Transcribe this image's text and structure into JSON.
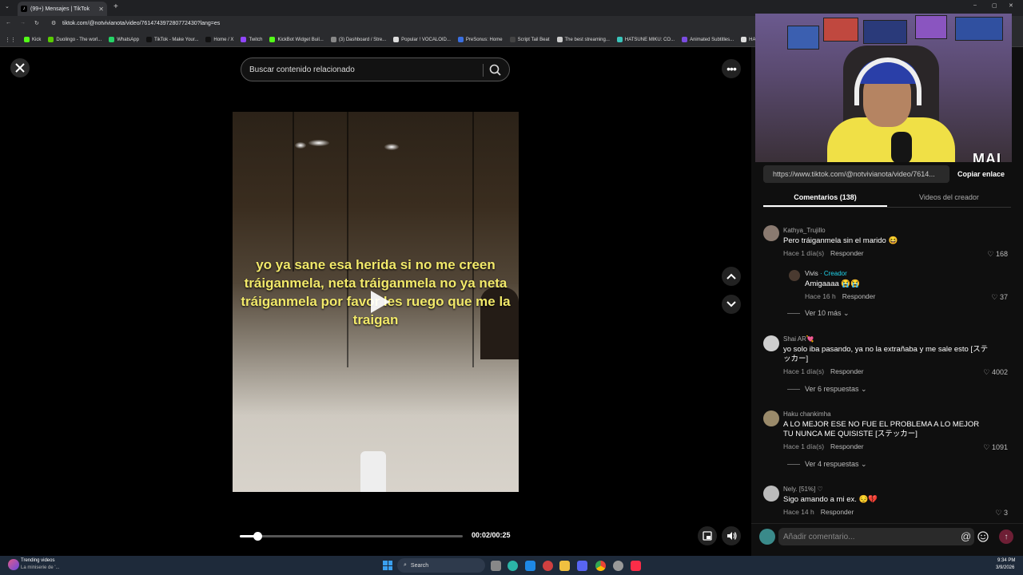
{
  "browser": {
    "tab_title": "(99+) Mensajes | TikTok",
    "url": "tiktok.com/@notvivianota/video/761474397280772430?lang=es",
    "bookmarks": [
      {
        "label": "Kick",
        "color": "#53fc18"
      },
      {
        "label": "Duolingo - The worl...",
        "color": "#58cc02"
      },
      {
        "label": "WhatsApp",
        "color": "#25d366"
      },
      {
        "label": "TikTok - Make Your...",
        "color": "#111111"
      },
      {
        "label": "Home / X",
        "color": "#111111"
      },
      {
        "label": "Twitch",
        "color": "#9146ff"
      },
      {
        "label": "KickBot Widget Buil...",
        "color": "#53fc18"
      },
      {
        "label": "(3) Dashboard / Stre...",
        "color": "#888888"
      },
      {
        "label": "Popular ! VOCALOID...",
        "color": "#dddddd"
      },
      {
        "label": "PreSonus: Home",
        "color": "#3a6fe0"
      },
      {
        "label": "Script Tail Beat",
        "color": "#444444"
      },
      {
        "label": "The best streaming...",
        "color": "#cccccc"
      },
      {
        "label": "HATSUNE MIKU: CO...",
        "color": "#39c5bb"
      },
      {
        "label": "Animated Subtitles...",
        "color": "#7a4ce0"
      },
      {
        "label": "HAT",
        "color": "#dddddd"
      }
    ]
  },
  "video": {
    "search_placeholder": "Buscar contenido relacionado",
    "caption": "yo ya sane esa herida si no me creen tráiganmela, neta tráiganmela no ya neta tráiganmela por favor les ruego que me la traigan",
    "time": "00:02/00:25",
    "progress": 0.08
  },
  "webcam": {
    "overlay_text": "MAI"
  },
  "panel": {
    "link": "https://www.tiktok.com/@notvivianota/video/7614...",
    "copy_label": "Copiar enlace",
    "tab_comments": "Comentarios (138)",
    "tab_videos": "Videos del creador",
    "comment_placeholder": "Añadir comentario...",
    "at_symbol": "@"
  },
  "comments": [
    {
      "user": "Kathya_Trujillo",
      "text": "Pero tráiganmela sin el marido 😆",
      "time": "Hace 1 día(s)",
      "reply": "Responder",
      "likes": "168"
    },
    {
      "user": "Vivis",
      "creator_tag": " · Creador",
      "text": "Amigaaaa 😭😭",
      "time": "Hace 16 h",
      "reply": "Responder",
      "likes": "37",
      "creator_color": "#20d5ec"
    },
    {
      "more": "Ver 10 más"
    },
    {
      "user": "Shai AR💘",
      "text": "yo solo iba pasando, ya no la extrañaba y me sale esto [ステッカー]",
      "time": "Hace 1 día(s)",
      "reply": "Responder",
      "likes": "4002"
    },
    {
      "more": "Ver 6 respuestas"
    },
    {
      "user": "Haku chankimha",
      "text": "A LO MEJOR ESE NO FUE EL PROBLEMA A LO MEJOR TU NUNCA ME QUISISTE [ステッカー]",
      "time": "Hace 1 día(s)",
      "reply": "Responder",
      "likes": "1091"
    },
    {
      "more": "Ver 4 respuestas"
    },
    {
      "user": "Nely. [51%] ♡",
      "text": "Sigo amando a mi ex. 😔💔",
      "time": "Hace 14 h",
      "reply": "Responder",
      "likes": "3"
    }
  ],
  "taskbar": {
    "widget_title": "Trending videos",
    "widget_sub": "La miniserie de '...",
    "search_label": "Search",
    "time": "9:34 PM",
    "date": "3/9/2026"
  }
}
